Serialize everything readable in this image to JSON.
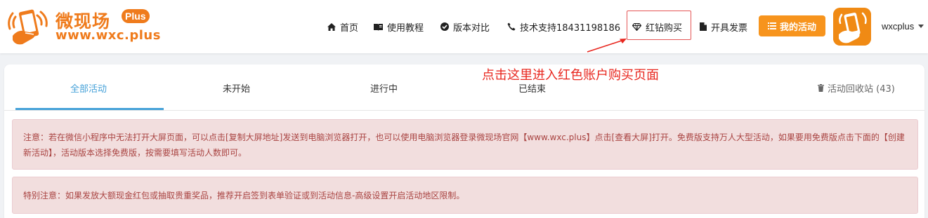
{
  "brand": {
    "name": "微现场",
    "badge": "Plus",
    "url": "www.wxc.plus",
    "color": "#ef7b1c"
  },
  "nav": {
    "home": "首页",
    "tutorial": "使用教程",
    "compare": "版本对比",
    "support": "技术支持18431198186",
    "red_diamond": "红钻购买",
    "invoice": "开具发票",
    "my_activity": "我的活动",
    "username": "wxcplus"
  },
  "annotation": "点击这里进入红色账户购买页面",
  "tabs": {
    "all": "全部活动",
    "not_started": "未开始",
    "in_progress": "进行中",
    "ended": "已结束",
    "recycle": "活动回收站 (43)"
  },
  "alerts": {
    "notice": "注意：若在微信小程序中无法打开大屏页面，可以点击[复制大屏地址]发送到电脑浏览器打开，也可以使用电脑浏览器登录微现场官网【www.wxc.plus】点击[查看大屏]打开。免费版支持万人大型活动，如果要用免费版点击下面的【创建新活动】，活动版本选择免费版，按需要填写活动人数即可。",
    "special": "特别注意：如果发放大额现金红包或抽取贵重奖品，推荐开启签到表单验证或到活动信息-高级设置开启活动地区限制。"
  },
  "colors": {
    "accent": "#45a1d8",
    "activity_button": "#f7941d",
    "alert_bg": "#f2dede",
    "alert_text": "#a94442",
    "annotation": "#e8271f"
  }
}
